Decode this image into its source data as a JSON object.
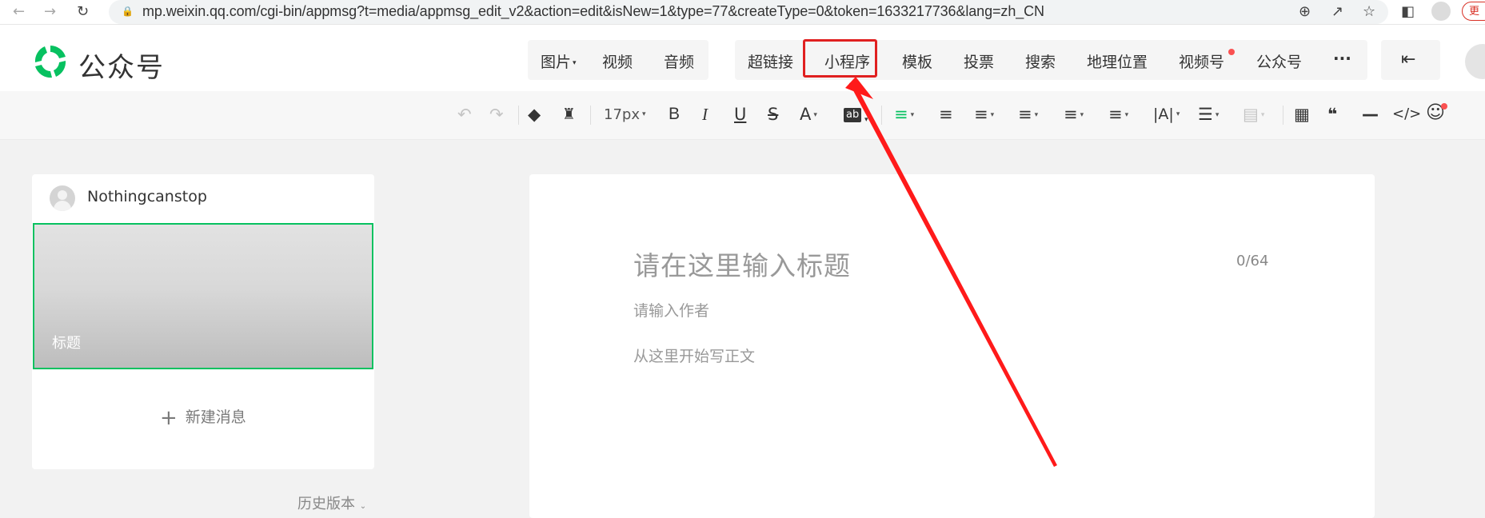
{
  "browser": {
    "url": "mp.weixin.qq.com/cgi-bin/appmsg?t=media/appmsg_edit_v2&action=edit&isNew=1&type=77&createType=0&token=1633217736&lang=zh_CN",
    "update_label": "更"
  },
  "header": {
    "brand": "公众号",
    "insert_group1": [
      "图片",
      "视频",
      "音频"
    ],
    "insert_group2": [
      "超链接",
      "小程序",
      "模板",
      "投票",
      "搜索",
      "地理位置",
      "视频号",
      "公众号",
      "···"
    ]
  },
  "toolbar": {
    "font_size": "17px"
  },
  "left": {
    "account_name": "Nothingcanstop",
    "article_title": "标题",
    "new_message": "新建消息",
    "history": "历史版本"
  },
  "editor": {
    "title_placeholder": "请在这里输入标题",
    "title_count": "0/64",
    "author_placeholder": "请输入作者",
    "body_placeholder": "从这里开始写正文"
  },
  "colors": {
    "accent": "#07c160",
    "annotation": "#e02020"
  }
}
